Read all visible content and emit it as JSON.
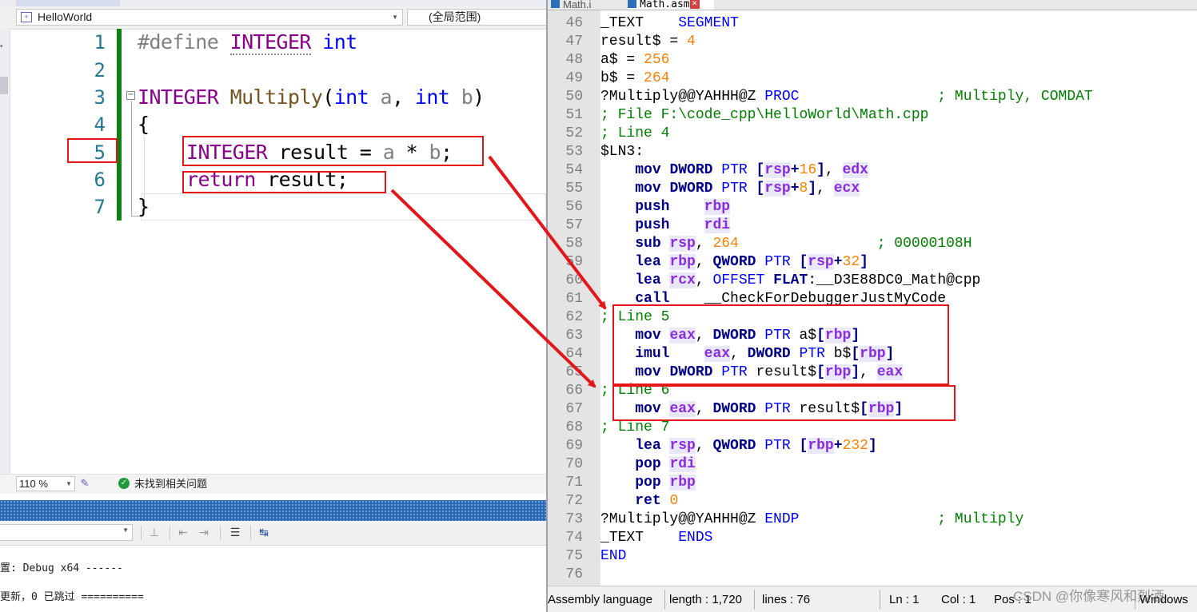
{
  "vs": {
    "project_combo": "HelloWorld",
    "scope_combo": "(全局范围)",
    "code_lines": [
      {
        "num": "1"
      },
      {
        "num": "2"
      },
      {
        "num": "3"
      },
      {
        "num": "4"
      },
      {
        "num": "5"
      },
      {
        "num": "6"
      },
      {
        "num": "7"
      }
    ],
    "tokens": {
      "define": "#define",
      "integer": "INTEGER",
      "int": "int",
      "multiply": "Multiply",
      "open_paren": "(",
      "a": "a",
      "comma_sp": ", ",
      "b": "b",
      "close_paren": ")",
      "lbrace": "{",
      "rbrace": "}",
      "result": "result",
      "assign": " = ",
      "mul": " * ",
      "semicolon": ";",
      "return": "return",
      "space": " "
    },
    "zoom": "110 %",
    "issues": "未找到相关问题",
    "output_lines": [
      "置: Debug x64 ------",
      "更新，0 已跳过 =========="
    ]
  },
  "npp": {
    "tabs": [
      {
        "label": "Math.i"
      },
      {
        "label": "Math.asm"
      }
    ],
    "lines": [
      {
        "num": "46"
      },
      {
        "num": "47"
      },
      {
        "num": "48"
      },
      {
        "num": "49"
      },
      {
        "num": "50"
      },
      {
        "num": "51"
      },
      {
        "num": "52"
      },
      {
        "num": "53"
      },
      {
        "num": "54"
      },
      {
        "num": "55"
      },
      {
        "num": "56"
      },
      {
        "num": "57"
      },
      {
        "num": "58"
      },
      {
        "num": "59"
      },
      {
        "num": "60"
      },
      {
        "num": "61"
      },
      {
        "num": "62"
      },
      {
        "num": "63"
      },
      {
        "num": "64"
      },
      {
        "num": "65"
      },
      {
        "num": "66"
      },
      {
        "num": "67"
      },
      {
        "num": "68"
      },
      {
        "num": "69"
      },
      {
        "num": "70"
      },
      {
        "num": "71"
      },
      {
        "num": "72"
      },
      {
        "num": "73"
      },
      {
        "num": "74"
      },
      {
        "num": "75"
      },
      {
        "num": "76"
      }
    ],
    "asm": {
      "text_seg": "_TEXT",
      "segment": "SEGMENT",
      "ends": "ENDS",
      "result_eq": "result$ = ",
      "v4": "4",
      "a_eq": "a$ = ",
      "v256": "256",
      "b_eq": "b$ = ",
      "v264": "264",
      "procname": "?Multiply@@YAHHH@Z",
      "proc": "PROC",
      "c_multiply_comdat": "; Multiply, COMDAT",
      "c_file": "; File F:\\code_cpp\\HelloWorld\\Math.cpp",
      "c_line4": "; Line 4",
      "ln3": "$LN3:",
      "mov": "mov",
      "push": "push",
      "sub": "sub",
      "lea": "lea",
      "call": "call",
      "imul": "imul",
      "pop": "pop",
      "ret": "ret",
      "dword": "DWORD",
      "qword": "QWORD",
      "ptr": "PTR",
      "rsp": "rsp",
      "rbp": "rbp",
      "rdi": "rdi",
      "rcx": "rcx",
      "edx": "edx",
      "ecx": "ecx",
      "eax": "eax",
      "v16": "16",
      "v8": "8",
      "v32": "32",
      "v232": "232",
      "v0": "0",
      "c_hex": "; 00000108H",
      "offset": "OFFSET",
      "flat": "FLAT",
      "math_sym": ":__D3E88DC0_Math@cpp",
      "jmc": "__CheckForDebuggerJustMyCode",
      "c_line5": "; Line 5",
      "c_line6": "; Line 6",
      "c_line7": "; Line 7",
      "a_sym": "a$",
      "b_sym": "b$",
      "result_sym": "result$",
      "endp": "ENDP",
      "c_multiply": "; Multiply",
      "end": "END"
    },
    "status": {
      "lang": "Assembly language",
      "length": "length : 1,720",
      "lines": "lines : 76",
      "ln": "Ln : 1",
      "col": "Col : 1",
      "pos": "Pos : 1",
      "eol": "Windows"
    },
    "watermark": "CSDN @你像寒风和烈酒"
  }
}
